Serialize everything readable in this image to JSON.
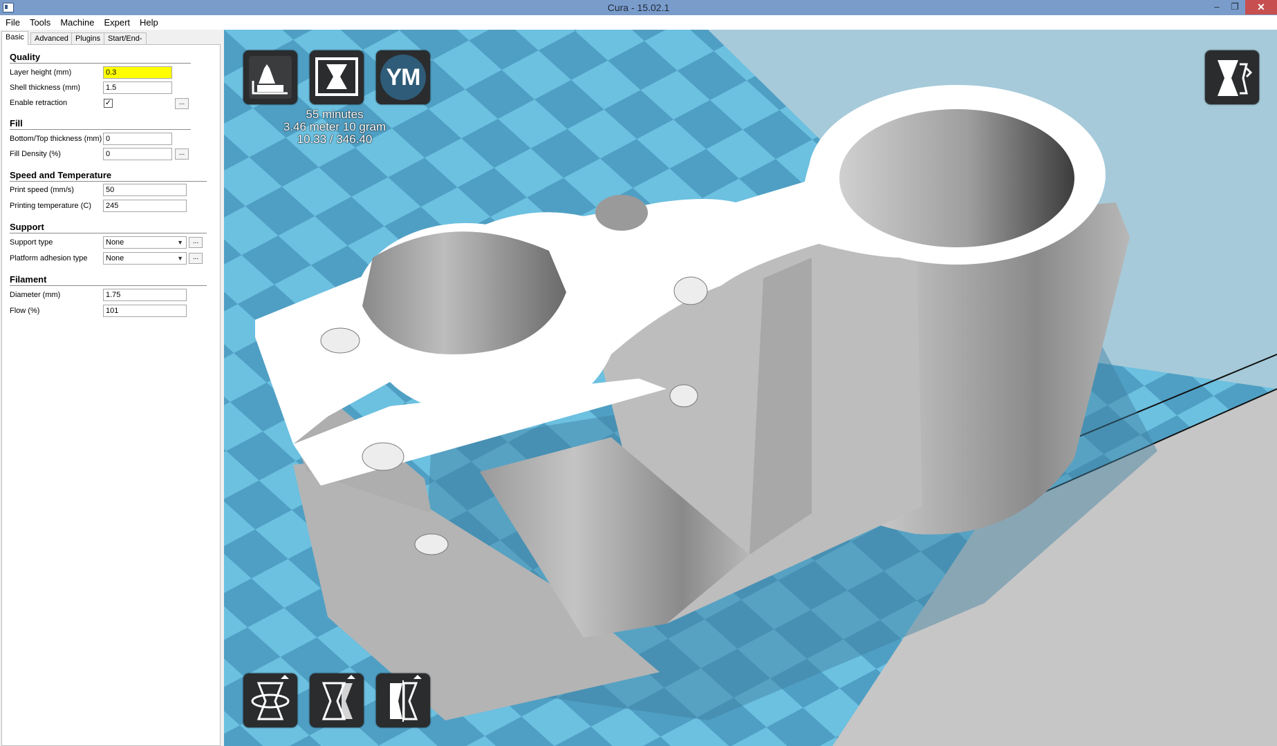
{
  "window": {
    "title": "Cura - 15.02.1",
    "app_icon": "cura-app-icon",
    "controls": {
      "minimize": "–",
      "maximize": "❐",
      "close": "✕"
    }
  },
  "menu": {
    "items": [
      "File",
      "Tools",
      "Machine",
      "Expert",
      "Help"
    ]
  },
  "tabs": [
    {
      "label": "Basic",
      "active": true
    },
    {
      "label": "Advanced",
      "active": false
    },
    {
      "label": "Plugins",
      "active": false
    },
    {
      "label": "Start/End-GCode",
      "active": false
    }
  ],
  "settings": {
    "quality": {
      "title": "Quality",
      "layer_height": {
        "label": "Layer height (mm)",
        "value": "0.3",
        "highlighted": true
      },
      "shell_thickness": {
        "label": "Shell thickness (mm)",
        "value": "1.5"
      },
      "enable_retraction": {
        "label": "Enable retraction",
        "checked": true,
        "check_mark": "✓",
        "more": "..."
      }
    },
    "fill": {
      "title": "Fill",
      "bottom_top_thickness": {
        "label": "Bottom/Top thickness (mm)",
        "value": "0"
      },
      "fill_density": {
        "label": "Fill Density (%)",
        "value": "0",
        "more": "..."
      }
    },
    "speed": {
      "title": "Speed and Temperature",
      "print_speed": {
        "label": "Print speed (mm/s)",
        "value": "50"
      },
      "printing_temperature": {
        "label": "Printing temperature (C)",
        "value": "245"
      }
    },
    "support": {
      "title": "Support",
      "support_type": {
        "label": "Support type",
        "value": "None",
        "more": "..."
      },
      "platform_adhesion": {
        "label": "Platform adhesion type",
        "value": "None",
        "more": "..."
      }
    },
    "filament": {
      "title": "Filament",
      "diameter": {
        "label": "Diameter (mm)",
        "value": "1.75"
      },
      "flow": {
        "label": "Flow (%)",
        "value": "101"
      }
    }
  },
  "viewport": {
    "buttons": {
      "load": "load-model-icon",
      "save_toolpath": "save-toolpath-icon",
      "ym_logo": "YM",
      "view_mode": "view-mode-icon",
      "rotate": "rotate-icon",
      "scale": "scale-icon",
      "mirror": "mirror-icon"
    },
    "stats": {
      "time": "55 minutes",
      "material": "3.46 meter 10 gram",
      "ratio": "10.33 / 346.40"
    },
    "colors": {
      "bed_light": "#6cc0e0",
      "bed_dark": "#4a99bf",
      "model": "#c8c8c8",
      "button_bg": "#2a2c2e",
      "highlight_field": "#ffff00"
    }
  }
}
